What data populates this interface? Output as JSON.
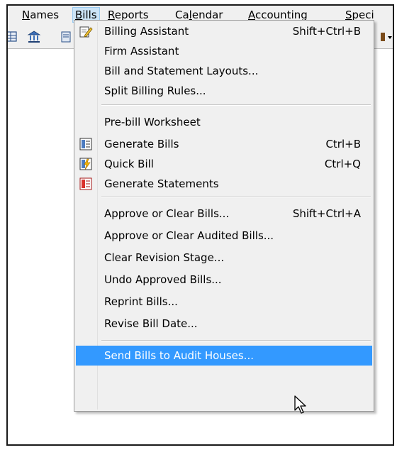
{
  "menubar": {
    "items": [
      {
        "text": "Names",
        "mn": "N",
        "rest": "ames"
      },
      {
        "text": "Bills",
        "mn": "B",
        "rest": "ills"
      },
      {
        "text": "Reports",
        "mn": "R",
        "rest": "eports"
      },
      {
        "text": "Calendar",
        "pre": "Ca",
        "mn": "l",
        "rest": "endar"
      },
      {
        "text": "Accounting",
        "mn": "A",
        "rest": "ccounting"
      },
      {
        "text": "Special",
        "mn": "S",
        "rest": "peci"
      }
    ]
  },
  "toolbar": {
    "icons": [
      "grid-icon",
      "bank-icon",
      "card-icon",
      "dropdown-arrow-icon"
    ]
  },
  "bills_menu": {
    "items": [
      {
        "label": "Billing Assistant",
        "shortcut": "Shift+Ctrl+B",
        "icon": "pencil-edit-icon"
      },
      {
        "label": "Firm Assistant",
        "shortcut": ""
      },
      {
        "label": "Bill and Statement Layouts...",
        "shortcut": ""
      },
      {
        "label": "Split Billing Rules...",
        "shortcut": ""
      },
      {
        "label": "Pre-bill Worksheet",
        "shortcut": ""
      },
      {
        "label": "Generate Bills",
        "shortcut": "Ctrl+B",
        "icon": "generate-bills-icon"
      },
      {
        "label": "Quick Bill",
        "shortcut": "Ctrl+Q",
        "icon": "quick-bill-icon"
      },
      {
        "label": "Generate Statements",
        "shortcut": "",
        "icon": "generate-statements-icon"
      },
      {
        "label": "Approve or Clear Bills...",
        "shortcut": "Shift+Ctrl+A"
      },
      {
        "label": "Approve or Clear Audited Bills...",
        "shortcut": ""
      },
      {
        "label": "Clear Revision Stage...",
        "shortcut": ""
      },
      {
        "label": "Undo Approved Bills...",
        "shortcut": ""
      },
      {
        "label": "Reprint Bills...",
        "shortcut": ""
      },
      {
        "label": "Revise Bill Date...",
        "shortcut": ""
      },
      {
        "label": "Send Bills to Audit Houses...",
        "shortcut": "",
        "highlighted": true
      }
    ]
  },
  "colors": {
    "highlight": "#3399ff",
    "menu_bg": "#f0f0f0",
    "active_menubar": "#cce4f7"
  }
}
